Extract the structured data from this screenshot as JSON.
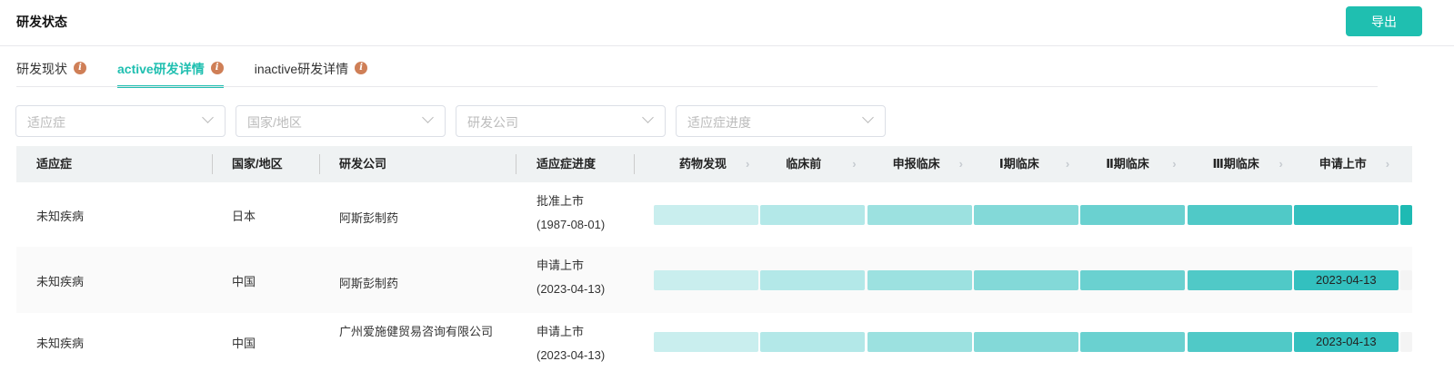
{
  "header": {
    "title": "研发状态",
    "export_label": "导出"
  },
  "tabs": [
    {
      "label": "研发现状"
    },
    {
      "label": "active研发详情"
    },
    {
      "label": "inactive研发详情"
    }
  ],
  "filters": [
    {
      "placeholder": "适应症"
    },
    {
      "placeholder": "国家/地区"
    },
    {
      "placeholder": "研发公司"
    },
    {
      "placeholder": "适应症进度"
    }
  ],
  "columns": [
    "适应症",
    "国家/地区",
    "研发公司",
    "适应症进度"
  ],
  "stages": [
    "药物发现",
    "临床前",
    "申报临床",
    "Ⅰ期临床",
    "Ⅱ期临床",
    "Ⅲ期临床",
    "申请上市"
  ],
  "stage_colors": [
    "#c9eeee",
    "#b3e8e8",
    "#9ce1e0",
    "#83d9d8",
    "#6ad1d0",
    "#50c9c7",
    "#33c0bf",
    "#1ebab3"
  ],
  "rows": [
    {
      "indication": "未知疾病",
      "country": "日本",
      "company": "阿斯彭制药",
      "progress": "批准上市",
      "progress_date": "(1987-08-01)",
      "stage_reached": 8,
      "bar_label": ""
    },
    {
      "indication": "未知疾病",
      "country": "中国",
      "company": "阿斯彭制药",
      "progress": "申请上市",
      "progress_date": "(2023-04-13)",
      "stage_reached": 7,
      "bar_label": "2023-04-13"
    },
    {
      "indication": "未知疾病",
      "country": "中国",
      "company": "广州爱施健贸易咨询有限公司",
      "progress": "申请上市",
      "progress_date": "(2023-04-13)",
      "stage_reached": 7,
      "bar_label": "2023-04-13"
    }
  ]
}
